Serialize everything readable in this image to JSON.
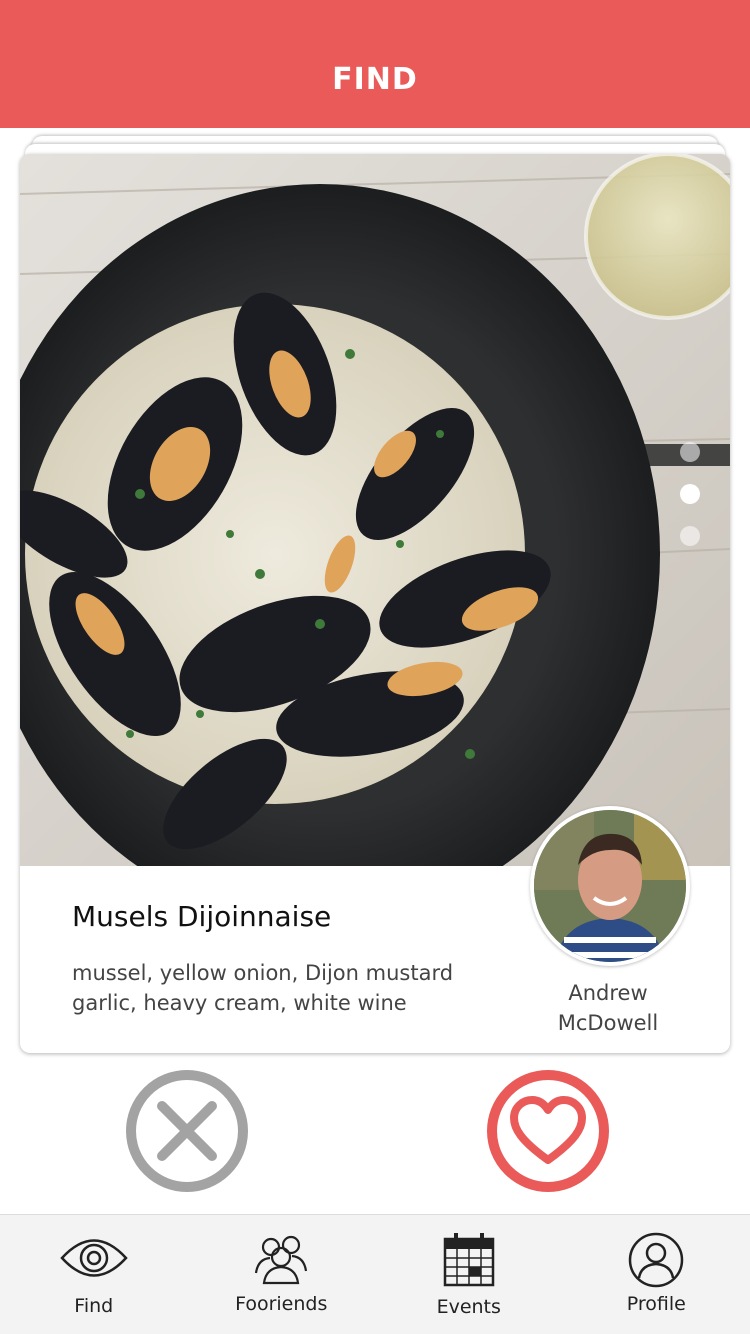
{
  "header": {
    "title": "FIND"
  },
  "card": {
    "dish_name": "Musels Dijoinnaise",
    "ingredients": "mussel, yellow onion, Dijon mustard garlic, heavy cream, white wine",
    "author": "Andrew McDowell",
    "photo_count": 3,
    "active_photo_index": 1
  },
  "actions": {
    "reject_icon": "close-icon",
    "like_icon": "heart-icon"
  },
  "tabbar": {
    "items": [
      {
        "label": "Find",
        "icon": "eye-icon"
      },
      {
        "label": "Fooriends",
        "icon": "people-icon"
      },
      {
        "label": "Events",
        "icon": "calendar-icon"
      },
      {
        "label": "Profile",
        "icon": "user-icon"
      }
    ]
  },
  "colors": {
    "brand_red": "#e95a58",
    "reject_gray": "#a3a3a3",
    "tabbar_bg": "#f3f3f3"
  }
}
